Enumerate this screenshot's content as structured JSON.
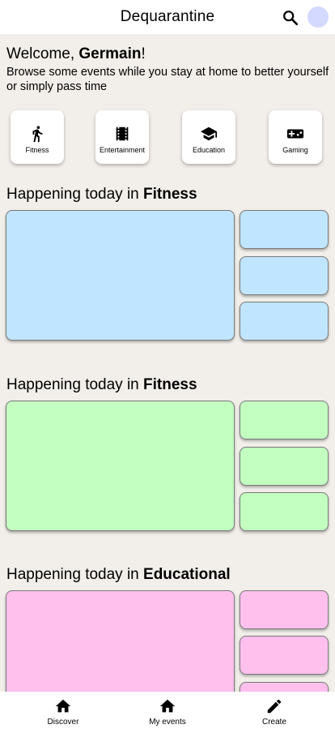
{
  "app": {
    "title": "Dequarantine"
  },
  "header": {
    "search_icon": "search-icon",
    "avatar_color": "#d3d9ff"
  },
  "welcome": {
    "greeting": "Welcome, ",
    "name": "Germain",
    "exclamation": "!",
    "subtitle": "Browse some events while you stay at home to better yourself or simply pass time"
  },
  "categories": [
    {
      "label": "Fitness",
      "icon": "running-icon"
    },
    {
      "label": "Entertainment",
      "icon": "film-icon"
    },
    {
      "label": "Education",
      "icon": "graduation-cap-icon"
    },
    {
      "label": "Gaming",
      "icon": "gamepad-icon"
    }
  ],
  "sections": [
    {
      "prefix": "Happening today in ",
      "category": "Fitness",
      "color": "#c0e6ff"
    },
    {
      "prefix": "Happening today in ",
      "category": "Fitness",
      "color": "#c3ffc1"
    },
    {
      "prefix": "Happening today in ",
      "category": "Educational",
      "color": "#ffc0ee"
    }
  ],
  "bottom_nav": [
    {
      "label": "Discover",
      "icon": "home-icon"
    },
    {
      "label": "My events",
      "icon": "home-icon"
    },
    {
      "label": "Create",
      "icon": "pencil-icon"
    }
  ]
}
